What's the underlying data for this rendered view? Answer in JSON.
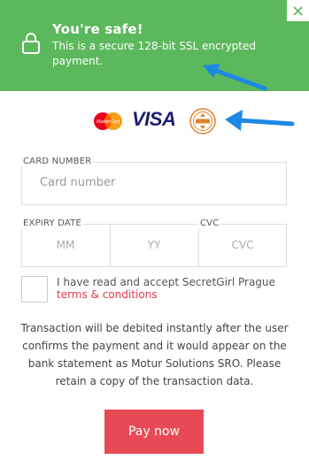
{
  "banner": {
    "title": "You're safe!",
    "message": "This is a secure 128-bit SSL encrypted payment.",
    "lock_icon": "lock-icon",
    "close_icon": "close-icon",
    "color": "#5cb85c"
  },
  "logos": {
    "mastercard_text": "MasterCard",
    "visa_text": "VISA",
    "badge_icon": "security-badge-icon"
  },
  "card": {
    "label": "CARD NUMBER",
    "placeholder": "Card number"
  },
  "expiry": {
    "label": "EXPIRY DATE",
    "month_placeholder": "MM",
    "year_placeholder": "YY"
  },
  "cvc": {
    "label": "CVC",
    "placeholder": "CVC"
  },
  "terms": {
    "text": "I have read and accept SecretGirl Prague",
    "link": "terms & conditions"
  },
  "notice": "Transaction will be debited instantly after the user confirms the payment and it would appear on the bank statement as Motur Solutions SRO. Please retain a copy of the transaction data.",
  "pay_button": "Pay now",
  "accent_color": "#e84a55",
  "annotation_color": "#1e88e5"
}
